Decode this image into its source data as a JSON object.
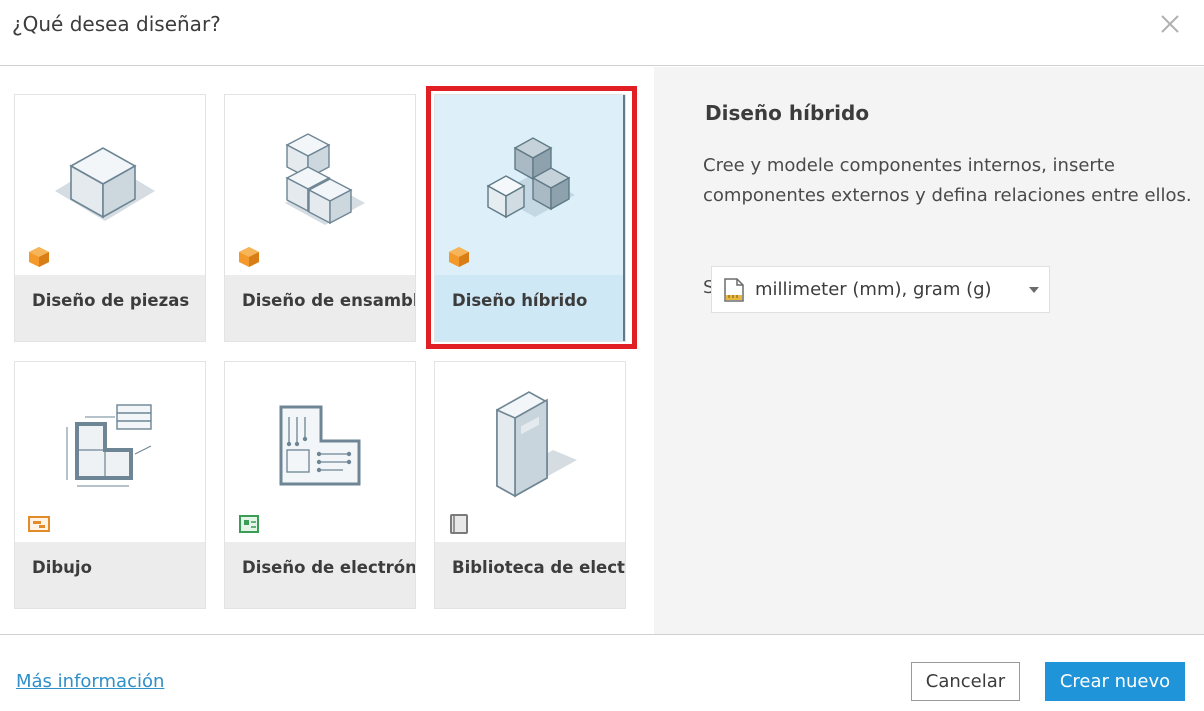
{
  "dialog": {
    "title": "¿Qué desea diseñar?",
    "close_icon": "close-icon"
  },
  "cards": [
    {
      "label": "Diseño de piezas",
      "icon": "part-cube-icon",
      "badge": "orange-cube-badge-icon",
      "selected": false
    },
    {
      "label": "Diseño de ensamblaje",
      "icon": "assembly-cubes-icon",
      "badge": "orange-cube-badge-icon",
      "selected": false
    },
    {
      "label": "Diseño híbrido",
      "icon": "hybrid-cubes-icon",
      "badge": "orange-cube-badge-icon",
      "selected": true
    },
    {
      "label": "Dibujo",
      "icon": "drawing-icon",
      "badge": "orange-drawing-badge-icon",
      "selected": false
    },
    {
      "label": "Diseño de electrónica",
      "icon": "pcb-icon",
      "badge": "green-pcb-badge-icon",
      "selected": false
    },
    {
      "label": "Biblioteca de electrónica",
      "icon": "library-book-icon",
      "badge": "gray-book-badge-icon",
      "selected": false
    }
  ],
  "detail": {
    "title": "Diseño híbrido",
    "description": "Cree y modele componentes internos, inserte componentes externos y defina relaciones entre ellos.",
    "units_prefix": "S",
    "units_value": "millimeter (mm), gram (g)"
  },
  "footer": {
    "more_info": "Más información",
    "cancel": "Cancelar",
    "create": "Crear nuevo"
  },
  "colors": {
    "accent": "#1f94d8",
    "highlight": "#e01e24",
    "selected_bg": "#ddf0fa",
    "badge_orange": "#f39a2b"
  }
}
